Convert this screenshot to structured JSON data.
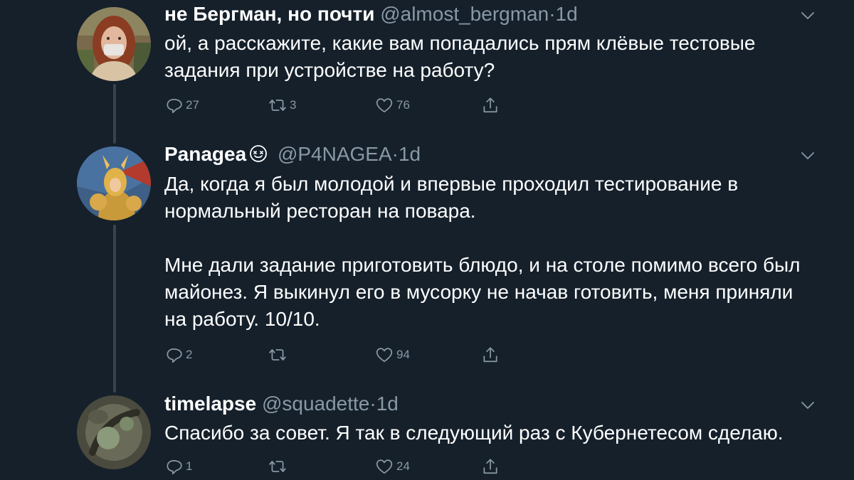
{
  "colors": {
    "background": "#15202b",
    "primary_text": "#ffffff",
    "secondary_text": "#8899a6",
    "thread_line": "#38444d"
  },
  "tweets": [
    {
      "name": "не Бергман, но почти",
      "handle": "@almost_bergman",
      "dot": "·",
      "time": "1d",
      "paragraphs": [
        "ой, а расскажите, какие вам попадались прям клёвые тестовые задания при устройстве на работу?"
      ],
      "replies": "27",
      "retweets": "3",
      "likes": "76",
      "icons": [
        "reply-icon",
        "retweet-icon",
        "like-icon",
        "share-icon",
        "chevron-down-icon"
      ]
    },
    {
      "name": "Panagea",
      "badge_icon": "emoji-badge-icon",
      "handle": "@P4NAGEA",
      "dot": "·",
      "time": "1d",
      "paragraphs": [
        "Да, когда я был молодой и впервые проходил тестирование в нормальный ресторан на повара.",
        "Мне дали задание приготовить блюдо, и на столе помимо всего был майонез. Я выкинул его в мусорку не начав готовить, меня приняли на работу. 10/10."
      ],
      "replies": "2",
      "retweets": "",
      "likes": "94",
      "icons": [
        "reply-icon",
        "retweet-icon",
        "like-icon",
        "share-icon",
        "chevron-down-icon"
      ]
    },
    {
      "name": "timelapse",
      "handle": "@squadette",
      "dot": "·",
      "time": "1d",
      "paragraphs": [
        "Спасибо за совет. Я так в следующий раз с Кубернетесом сделаю."
      ],
      "replies": "1",
      "retweets": "",
      "likes": "24",
      "icons": [
        "reply-icon",
        "retweet-icon",
        "like-icon",
        "share-icon",
        "chevron-down-icon"
      ]
    }
  ]
}
